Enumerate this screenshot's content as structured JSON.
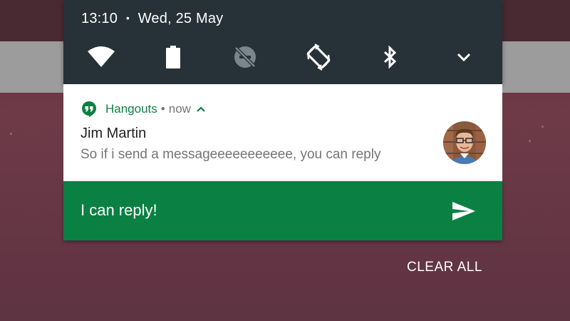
{
  "status": {
    "time": "13:10",
    "separator": "•",
    "date": "Wed, 25 May"
  },
  "quick_settings": [
    {
      "icon": "wifi-icon"
    },
    {
      "icon": "battery-icon"
    },
    {
      "icon": "do-not-disturb-off-icon"
    },
    {
      "icon": "auto-rotate-icon"
    },
    {
      "icon": "bluetooth-icon"
    },
    {
      "icon": "chevron-down-icon"
    }
  ],
  "notification": {
    "app_name": "Hangouts",
    "separator": "•",
    "time": "now",
    "sender": "Jim Martin",
    "message": "So if i send a messageeeeeeeeeee, you can reply",
    "accent_color": "#0b8043"
  },
  "reply": {
    "value": "I can reply!",
    "send_icon": "send-icon"
  },
  "clear_all_label": "CLEAR ALL",
  "colors": {
    "shade": "#263238",
    "hangouts_green": "#0b8043",
    "background": "#5e3342"
  }
}
